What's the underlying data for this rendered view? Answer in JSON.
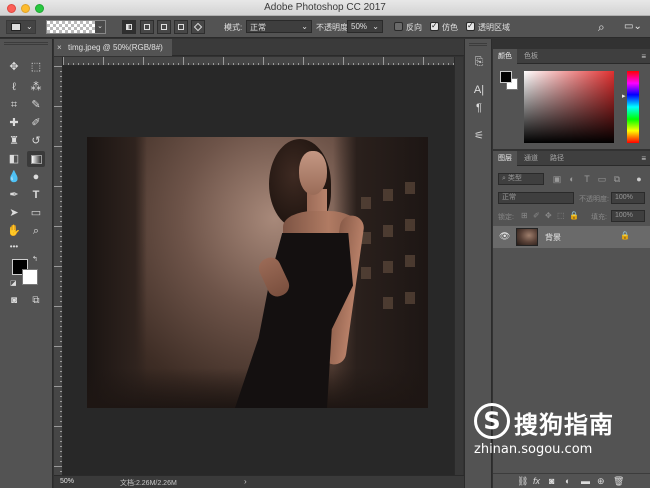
{
  "window": {
    "title": "Adobe Photoshop CC 2017"
  },
  "options_bar": {
    "mode_label": "模式:",
    "mode_value": "正常",
    "opacity_label": "不透明度:",
    "opacity_value": "50%",
    "reverse_label": "反向",
    "reverse_checked": false,
    "dither_label": "仿色",
    "dither_checked": true,
    "transparency_label": "透明区域",
    "transparency_checked": true,
    "icons": [
      "tool-preset-icon",
      "linear-gradient-icon",
      "radial-gradient-icon",
      "angle-gradient-icon",
      "reflected-gradient-icon",
      "diamond-gradient-icon",
      "search-icon",
      "workspace-icon"
    ]
  },
  "document": {
    "tab_label": "timg.jpeg @ 50%(RGB/8#)",
    "close_glyph": "×"
  },
  "status_bar": {
    "zoom": "50%",
    "doc_size": "文档:2.26M/2.26M",
    "arrow": "›"
  },
  "tools": {
    "foreground_color": "#000000",
    "background_color": "#ffffff",
    "more_glyph": "•••"
  },
  "color_panel": {
    "tabs": [
      "颜色",
      "色板"
    ],
    "active_tab": 0
  },
  "layers_panel": {
    "tabs": [
      "图层",
      "通道",
      "路径"
    ],
    "active_tab": 0,
    "filter_placeholder": "类型",
    "blend_mode": "正常",
    "opacity_label": "不透明度:",
    "opacity_value": "100%",
    "lock_label": "锁定:",
    "fill_label": "填充:",
    "fill_value": "100%",
    "layers": [
      {
        "name": "背景",
        "visible": true,
        "locked": true
      }
    ],
    "bottom_icons": [
      "link-icon",
      "fx-icon",
      "mask-icon",
      "adjustment-icon",
      "group-icon",
      "new-layer-icon",
      "trash-icon"
    ],
    "fx_label": "fx"
  },
  "watermark": {
    "logo_letter": "S",
    "brand": "搜狗指南",
    "url": "zhinan.sogou.com"
  }
}
